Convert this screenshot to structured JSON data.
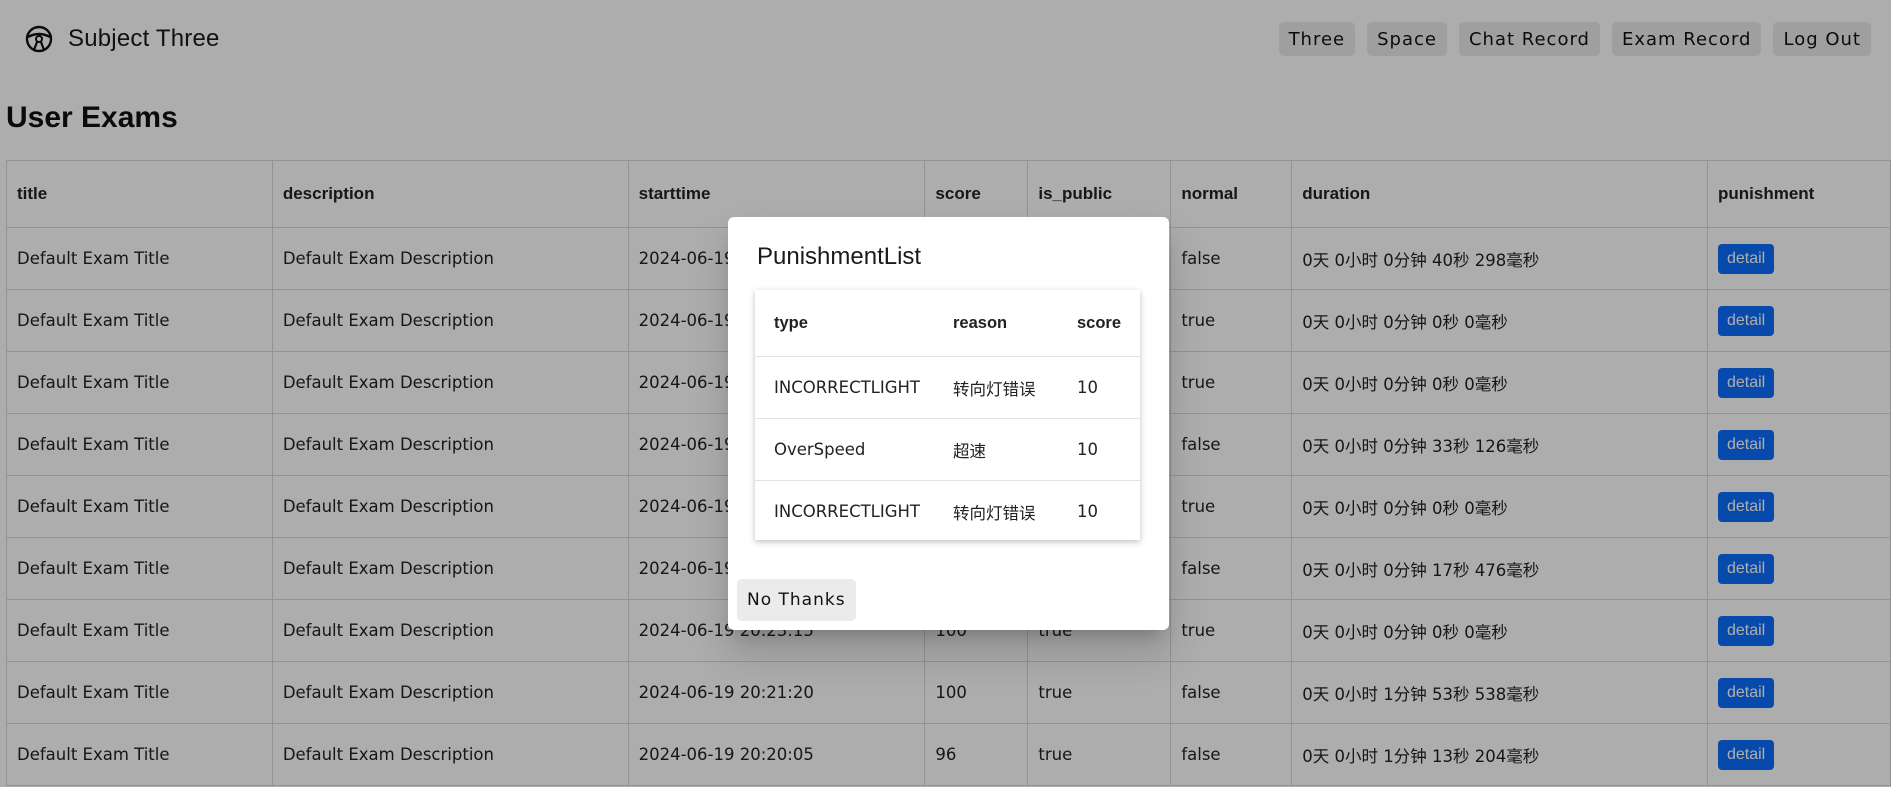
{
  "app": {
    "title": "Subject Three",
    "logo_icon": "steering-wheel-icon"
  },
  "nav": {
    "buttons": [
      "Three",
      "Space",
      "Chat Record",
      "Exam Record",
      "Log Out"
    ]
  },
  "page": {
    "title": "User Exams"
  },
  "table": {
    "headers": [
      "title",
      "description",
      "starttime",
      "score",
      "is_public",
      "normal",
      "duration",
      "punishment"
    ],
    "rows": [
      {
        "title": "Default Exam Title",
        "description": "Default Exam Description",
        "starttime": "2024-06-19",
        "score": "",
        "is_public": "",
        "normal": "false",
        "duration": "0天 0小时 0分钟 40秒 298毫秒",
        "action": "detail"
      },
      {
        "title": "Default Exam Title",
        "description": "Default Exam Description",
        "starttime": "2024-06-19",
        "score": "",
        "is_public": "",
        "normal": "true",
        "duration": "0天 0小时 0分钟 0秒 0毫秒",
        "action": "detail"
      },
      {
        "title": "Default Exam Title",
        "description": "Default Exam Description",
        "starttime": "2024-06-19",
        "score": "",
        "is_public": "",
        "normal": "true",
        "duration": "0天 0小时 0分钟 0秒 0毫秒",
        "action": "detail"
      },
      {
        "title": "Default Exam Title",
        "description": "Default Exam Description",
        "starttime": "2024-06-19",
        "score": "",
        "is_public": "",
        "normal": "false",
        "duration": "0天 0小时 0分钟 33秒 126毫秒",
        "action": "detail"
      },
      {
        "title": "Default Exam Title",
        "description": "Default Exam Description",
        "starttime": "2024-06-19",
        "score": "",
        "is_public": "",
        "normal": "true",
        "duration": "0天 0小时 0分钟 0秒 0毫秒",
        "action": "detail"
      },
      {
        "title": "Default Exam Title",
        "description": "Default Exam Description",
        "starttime": "2024-06-19",
        "score": "",
        "is_public": "",
        "normal": "false",
        "duration": "0天 0小时 0分钟 17秒 476毫秒",
        "action": "detail"
      },
      {
        "title": "Default Exam Title",
        "description": "Default Exam Description",
        "starttime": "2024-06-19 20:23:15",
        "score": "100",
        "is_public": "true",
        "normal": "true",
        "duration": "0天 0小时 0分钟 0秒 0毫秒",
        "action": "detail"
      },
      {
        "title": "Default Exam Title",
        "description": "Default Exam Description",
        "starttime": "2024-06-19 20:21:20",
        "score": "100",
        "is_public": "true",
        "normal": "false",
        "duration": "0天 0小时 1分钟 53秒 538毫秒",
        "action": "detail"
      },
      {
        "title": "Default Exam Title",
        "description": "Default Exam Description",
        "starttime": "2024-06-19 20:20:05",
        "score": "96",
        "is_public": "true",
        "normal": "false",
        "duration": "0天 0小时 1分钟 13秒 204毫秒",
        "action": "detail"
      }
    ]
  },
  "modal": {
    "title": "PunishmentList",
    "headers": [
      "type",
      "reason",
      "score"
    ],
    "rows": [
      {
        "type": "INCORRECTLIGHT",
        "reason": "转向灯错误",
        "score": "10"
      },
      {
        "type": "OverSpeed",
        "reason": "超速",
        "score": "10"
      },
      {
        "type": "INCORRECTLIGHT",
        "reason": "转向灯错误",
        "score": "10"
      }
    ],
    "close_label": "No Thanks"
  },
  "colors": {
    "overlay": "#000000",
    "detail_button": "#0d6efd",
    "nav_button": "#ebebeb"
  }
}
